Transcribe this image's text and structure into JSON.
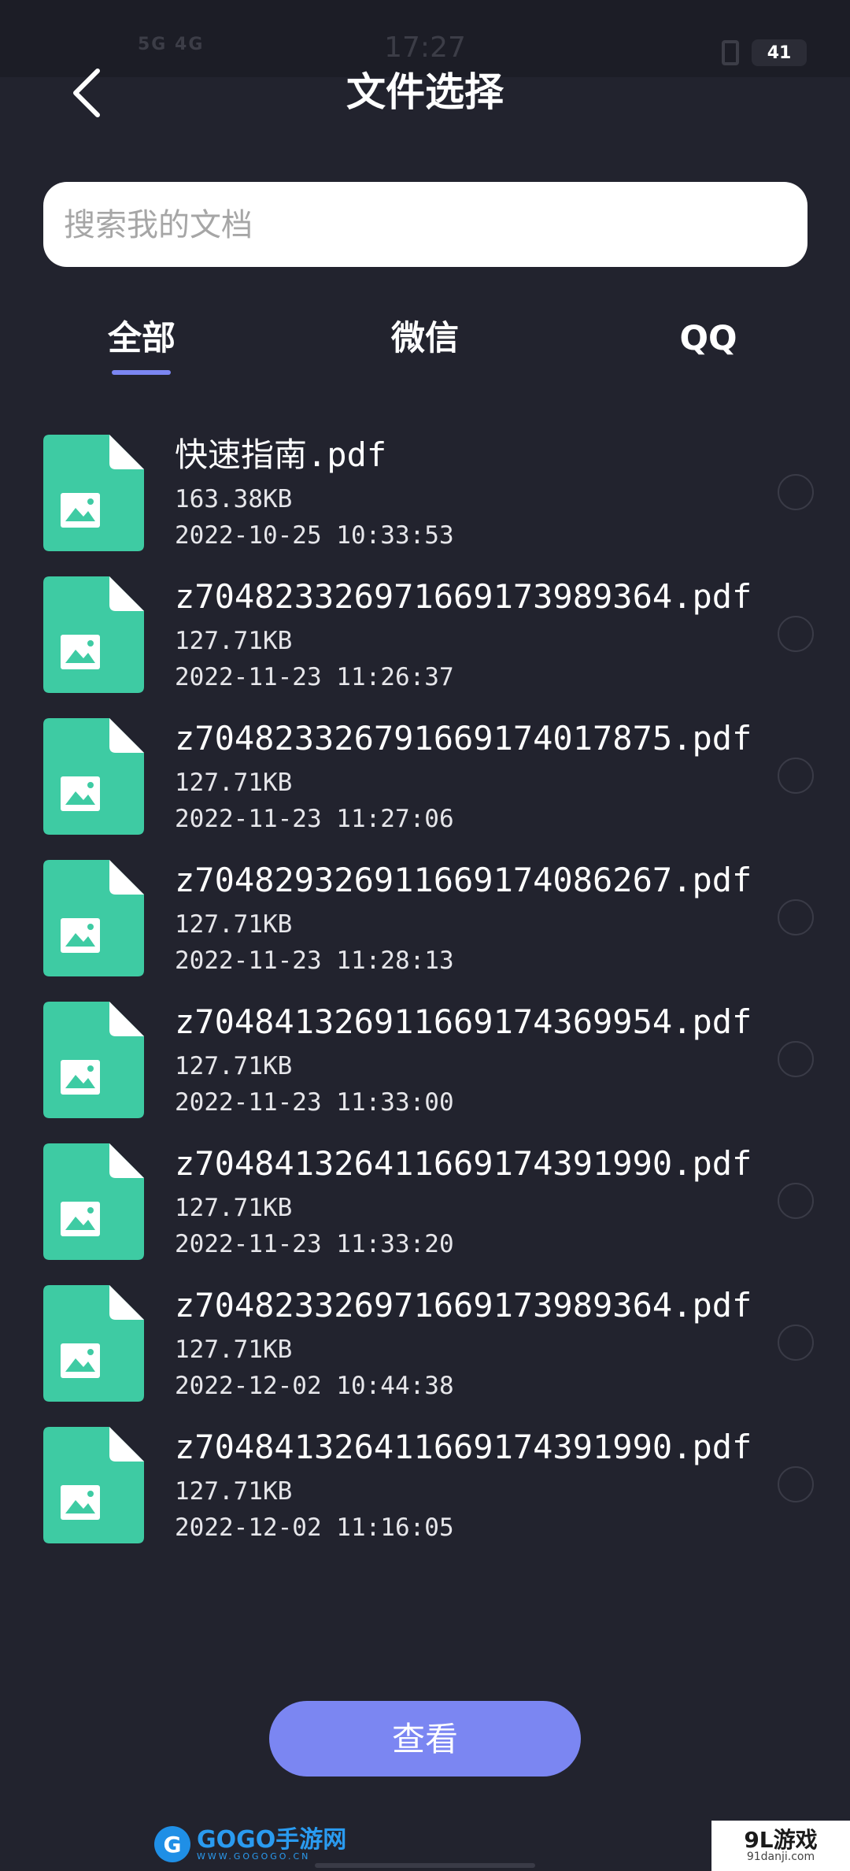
{
  "status_bar": {
    "signal_text": "5G 4G",
    "time": "17:27",
    "battery": "41"
  },
  "header": {
    "title": "文件选择"
  },
  "search": {
    "placeholder": "搜索我的文档"
  },
  "tabs": [
    {
      "label": "全部",
      "selected": true
    },
    {
      "label": "微信",
      "selected": false
    },
    {
      "label": "QQ",
      "selected": false
    }
  ],
  "files": [
    {
      "name": "快速指南.pdf",
      "size": "163.38KB",
      "date": "2022-10-25 10:33:53",
      "selected": false
    },
    {
      "name": "z70482332697166917398936​4.pdf",
      "size": "127.71KB",
      "date": "2022-11-23 11:26:37",
      "selected": false
    },
    {
      "name": "z704823326791669174017875.pdf",
      "size": "127.71KB",
      "date": "2022-11-23 11:27:06",
      "selected": false
    },
    {
      "name": "z704829326911669174086267.pdf",
      "size": "127.71KB",
      "date": "2022-11-23 11:28:13",
      "selected": false
    },
    {
      "name": "z704841326911669174369954.pdf",
      "size": "127.71KB",
      "date": "2022-11-23 11:33:00",
      "selected": false
    },
    {
      "name": "z704841326411669174391990.pdf",
      "size": "127.71KB",
      "date": "2022-11-23 11:33:20",
      "selected": false
    },
    {
      "name": "z704823326971669173989364.pdf",
      "size": "127.71KB",
      "date": "2022-12-02 10:44:38",
      "selected": false
    },
    {
      "name": "z704841326411669174391990.pdf",
      "size": "127.71KB",
      "date": "2022-12-02 11:16:05",
      "selected": false
    }
  ],
  "actions": {
    "view_label": "查看"
  },
  "watermarks": {
    "left_badge": "G",
    "left_title": "GOGO手游网",
    "left_url": "WWW.GOGOGO.CN",
    "right_title": "9L游戏",
    "right_url": "91danji.com"
  },
  "colors": {
    "background": "#22232e",
    "accent": "#7b86f2",
    "file_icon": "#3ecba3"
  },
  "icons": {
    "back": "chevron-left-icon",
    "file": "image-file-icon"
  }
}
